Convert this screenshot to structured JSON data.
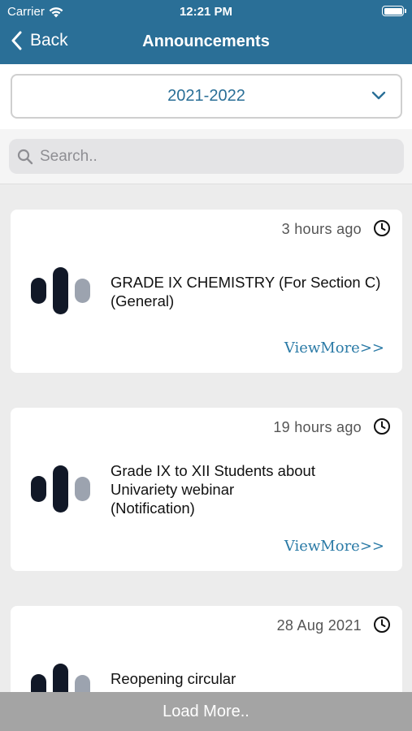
{
  "status_bar": {
    "carrier": "Carrier",
    "time": "12:21 PM"
  },
  "nav": {
    "back_label": "Back",
    "title": "Announcements"
  },
  "year_picker": {
    "value": "2021-2022"
  },
  "search": {
    "placeholder": "Search.."
  },
  "announcements": [
    {
      "time": "3 hours ago",
      "title_lines": [
        "GRADE IX CHEMISTRY (For Section C)",
        "(General)"
      ],
      "action": "ViewMore>>"
    },
    {
      "time": "19 hours ago",
      "title_lines": [
        "Grade IX to XII Students about",
        "Univariety webinar",
        "(Notification)"
      ],
      "action": "ViewMore>>"
    },
    {
      "time": "28 Aug 2021",
      "title_lines": [
        "Reopening circular"
      ],
      "action": ""
    }
  ],
  "load_more_label": "Load More..",
  "colors": {
    "header": "#2a6f97",
    "accent": "#2a7aa6",
    "load_more_bg": "#a4a4a4"
  }
}
